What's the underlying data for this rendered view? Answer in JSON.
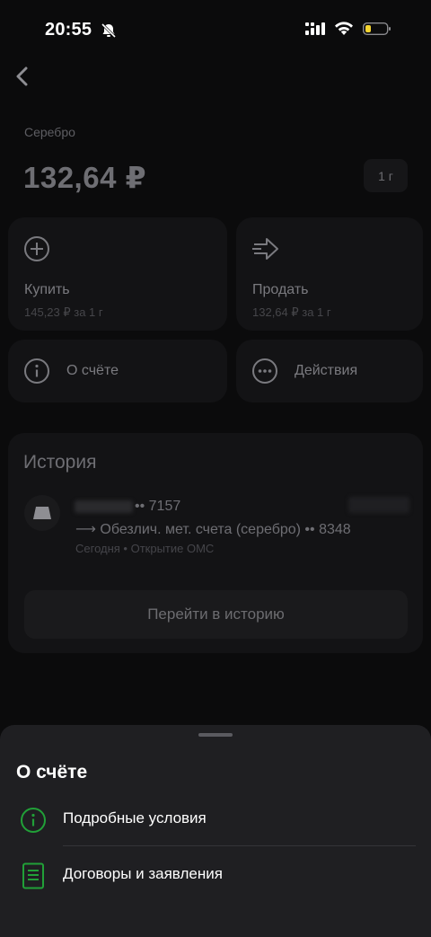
{
  "status": {
    "time": "20:55"
  },
  "metal": {
    "label": "Серебро",
    "price": "132,64 ₽",
    "unit": "1 г"
  },
  "actions": {
    "buy_label": "Купить",
    "buy_price": "145,23 ₽ за 1 г",
    "sell_label": "Продать",
    "sell_price": "132,64 ₽ за 1 г",
    "about_label": "О счёте",
    "more_label": "Действия"
  },
  "history": {
    "title": "История",
    "tx_from": "•• 7157",
    "tx_to": "⟶ Обезлич. мет. счета (серебро) •• 8348",
    "tx_meta": "Сегодня • Открытие ОМС",
    "go_button": "Перейти в историю"
  },
  "sheet": {
    "title": "О счёте",
    "items": [
      {
        "label": "Подробные условия",
        "icon": "info-icon"
      },
      {
        "label": "Договоры и заявления",
        "icon": "document-icon"
      }
    ]
  },
  "colors": {
    "accent_green": "#21a038",
    "sheet_bg": "#1f1f22",
    "screen_bg": "#0b0b0c"
  }
}
